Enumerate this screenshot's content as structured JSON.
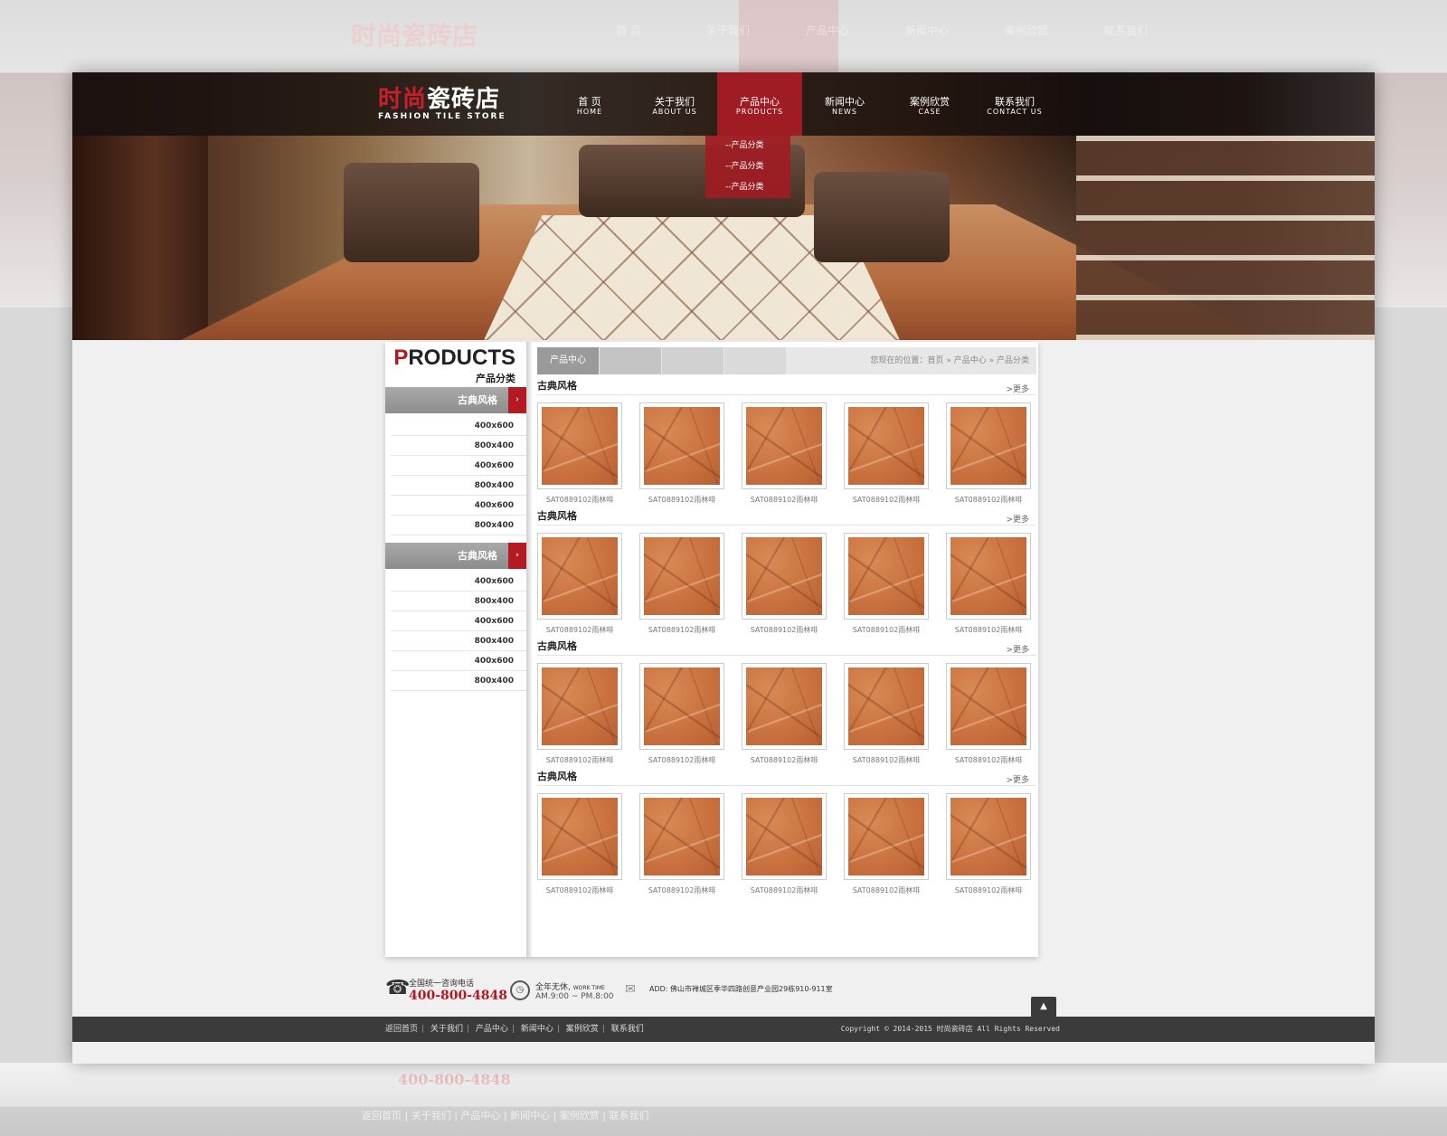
{
  "logo": {
    "cn_red": "时尚",
    "cn_white": "瓷砖店",
    "en": "FASHION TILE STORE"
  },
  "nav": [
    {
      "cn": "首 页",
      "en": "HOME"
    },
    {
      "cn": "关于我们",
      "en": "ABOUT US"
    },
    {
      "cn": "产品中心",
      "en": "PRODUCTS"
    },
    {
      "cn": "新闻中心",
      "en": "NEWS"
    },
    {
      "cn": "案例欣赏",
      "en": "CASE"
    },
    {
      "cn": "联系我们",
      "en": "CONTACT US"
    }
  ],
  "active_nav_index": 2,
  "dropdown": [
    "--产品分类",
    "--产品分类",
    "--产品分类"
  ],
  "sidebar": {
    "title_first": "P",
    "title_rest": "RODUCTS",
    "subtitle": "产品分类",
    "groups": [
      {
        "label": "古典风格",
        "items": [
          "400x600",
          "800x400",
          "400x600",
          "800x400",
          "400x600",
          "800x400"
        ]
      },
      {
        "label": "古典风格",
        "items": [
          "400x600",
          "800x400",
          "400x600",
          "800x400",
          "400x600",
          "800x400"
        ]
      }
    ]
  },
  "tabs": [
    "产品中心",
    "",
    "",
    ""
  ],
  "breadcrumb": {
    "prefix": "您现在的位置：",
    "home": "首页",
    "sep": "»",
    "mid": "产品中心",
    "current": "产品分类"
  },
  "sections": [
    {
      "title": "古典风格",
      "more": ">更多",
      "items": [
        "SAT0889102雨林啡",
        "SAT0889102雨林啡",
        "SAT0889102雨林啡",
        "SAT0889102雨林啡",
        "SAT0889102雨林啡"
      ]
    },
    {
      "title": "古典风格",
      "more": ">更多",
      "items": [
        "SAT0889102雨林啡",
        "SAT0889102雨林啡",
        "SAT0889102雨林啡",
        "SAT0889102雨林啡",
        "SAT0889102雨林啡"
      ]
    },
    {
      "title": "古典风格",
      "more": ">更多",
      "items": [
        "SAT0889102雨林啡",
        "SAT0889102雨林啡",
        "SAT0889102雨林啡",
        "SAT0889102雨林啡",
        "SAT0889102雨林啡"
      ]
    },
    {
      "title": "古典风格",
      "more": ">更多",
      "items": [
        "SAT0889102雨林啡",
        "SAT0889102雨林啡",
        "SAT0889102雨林啡",
        "SAT0889102雨林啡",
        "SAT0889102雨林啡"
      ]
    }
  ],
  "contact": {
    "phone_label": "全国统一咨询电话",
    "phone": "400-800-4848",
    "time_label": "全年无休",
    "time_label_en": "WORK TIME",
    "time": "AM.9:00 ~ PM.8:00",
    "address": "ADD: 佛山市禅城区季华四路创意产业园29栋910-911室"
  },
  "footer": {
    "links": [
      "返回首页",
      "关于我们",
      "产品中心",
      "新闻中心",
      "案例欣赏",
      "联系我们"
    ],
    "copyright": "Copyright © 2014-2015 时尚瓷砖店 All Rights Reserved"
  },
  "colors": {
    "brand_red": "#b31820",
    "nav_active": "#a01c24",
    "footer": "#3b3b3b"
  },
  "icons": {
    "phone": "phone-icon",
    "clock": "clock-icon",
    "address": "map-icon",
    "top": "back-to-top-icon"
  }
}
